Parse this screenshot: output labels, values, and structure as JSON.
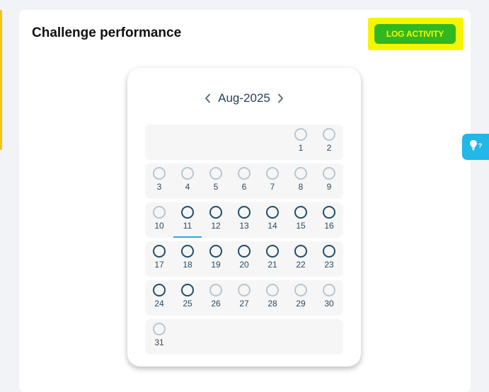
{
  "card": {
    "title": "Challenge performance",
    "log_activity_label": "LOG ACTIVITY"
  },
  "calendar": {
    "month_label": "Aug-2025",
    "prev_icon": "chevron-left-icon",
    "next_icon": "chevron-right-icon",
    "today": 11,
    "weeks": [
      [
        null,
        null,
        null,
        null,
        null,
        {
          "day": "1",
          "active": false
        },
        {
          "day": "2",
          "active": false
        }
      ],
      [
        {
          "day": "3",
          "active": false
        },
        {
          "day": "4",
          "active": false
        },
        {
          "day": "5",
          "active": false
        },
        {
          "day": "6",
          "active": false
        },
        {
          "day": "7",
          "active": false
        },
        {
          "day": "8",
          "active": false
        },
        {
          "day": "9",
          "active": false
        }
      ],
      [
        {
          "day": "10",
          "active": false
        },
        {
          "day": "11",
          "active": true
        },
        {
          "day": "12",
          "active": true
        },
        {
          "day": "13",
          "active": true
        },
        {
          "day": "14",
          "active": true
        },
        {
          "day": "15",
          "active": true
        },
        {
          "day": "16",
          "active": true
        }
      ],
      [
        {
          "day": "17",
          "active": true
        },
        {
          "day": "18",
          "active": true
        },
        {
          "day": "19",
          "active": true
        },
        {
          "day": "20",
          "active": true
        },
        {
          "day": "21",
          "active": true
        },
        {
          "day": "22",
          "active": true
        },
        {
          "day": "23",
          "active": true
        }
      ],
      [
        {
          "day": "24",
          "active": true
        },
        {
          "day": "25",
          "active": true
        },
        {
          "day": "26",
          "active": false
        },
        {
          "day": "27",
          "active": false
        },
        {
          "day": "28",
          "active": false
        },
        {
          "day": "29",
          "active": false
        },
        {
          "day": "30",
          "active": false
        }
      ],
      [
        {
          "day": "31",
          "active": false
        },
        null,
        null,
        null,
        null,
        null,
        null
      ]
    ]
  },
  "help_tab": {
    "icon": "lightbulb-icon",
    "mark": "?"
  },
  "colors": {
    "accent_yellow": "#f3c316",
    "button_green": "#31b820",
    "highlight_yellow": "#f5f500",
    "ring_active": "#1f4d6a",
    "ring_inactive": "#b7c7cf",
    "today_underline": "#2fa8e0",
    "help_blue": "#21b7e6"
  }
}
